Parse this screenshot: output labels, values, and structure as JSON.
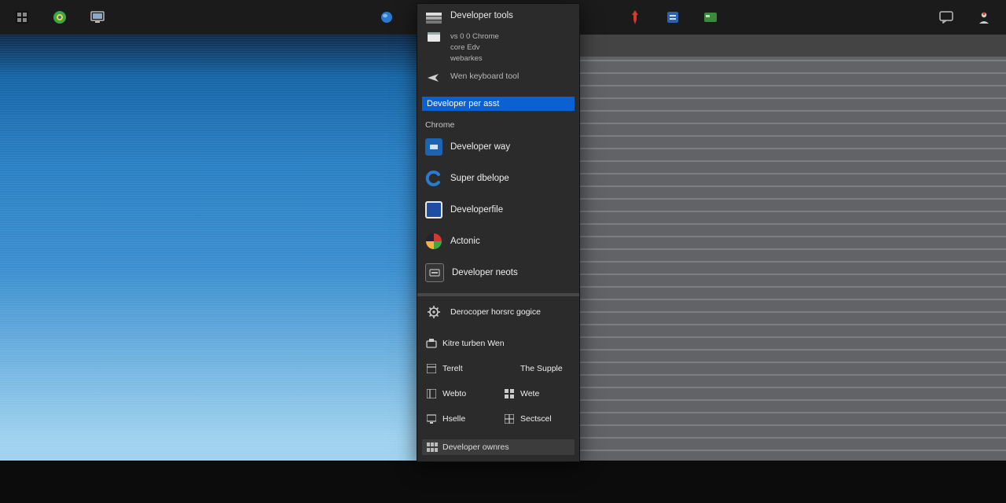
{
  "taskbar_icons": {
    "left": [
      "start",
      "chrome-green",
      "monitor"
    ],
    "middle": [
      "ball-blue",
      "window-blue"
    ],
    "middle2": [
      "pin-red",
      "tile-blue",
      "card-green"
    ],
    "right": [
      "chat",
      "user"
    ]
  },
  "start_menu": {
    "top": {
      "title": "Developer tools",
      "sublines": [
        "vs 0 0 Chrome",
        "core Edv",
        "webarkes"
      ],
      "keyboard_item": "Wen keyboard tool"
    },
    "search_value": "Developer per asst",
    "section_header": "Chrome",
    "apps": [
      {
        "label": "Developer way",
        "icon": "tile-blue",
        "bg": "#1a63b5"
      },
      {
        "label": "Super dbelope",
        "icon": "c-blue",
        "bg": "transparent"
      },
      {
        "label": "Developerfile",
        "icon": "doc-blue",
        "bg": "#1d4fa0"
      },
      {
        "label": "Actonic",
        "icon": "swirl",
        "bg": "transparent"
      },
      {
        "label": "Developer neots",
        "icon": "card-dark",
        "bg": "#353535"
      }
    ],
    "bottom_single": {
      "label": "Derocoper horsrc gogice",
      "icon": "gear"
    },
    "grid": [
      {
        "label": "Kitre turben Wen",
        "icon": "tray",
        "span": "full"
      },
      {
        "label": "Terelt",
        "icon": "panel"
      },
      {
        "label": "The  Supple",
        "icon": ""
      },
      {
        "label": "Webto",
        "icon": "panel"
      },
      {
        "label": "Wete",
        "icon": "grid4"
      },
      {
        "label": "Hselle",
        "icon": "screen"
      },
      {
        "label": "Sectscel",
        "icon": "grid4b"
      }
    ],
    "footer": "Developer ownres"
  },
  "colors": {
    "accent": "#0b61d1",
    "panel": "#2b2b2b"
  }
}
